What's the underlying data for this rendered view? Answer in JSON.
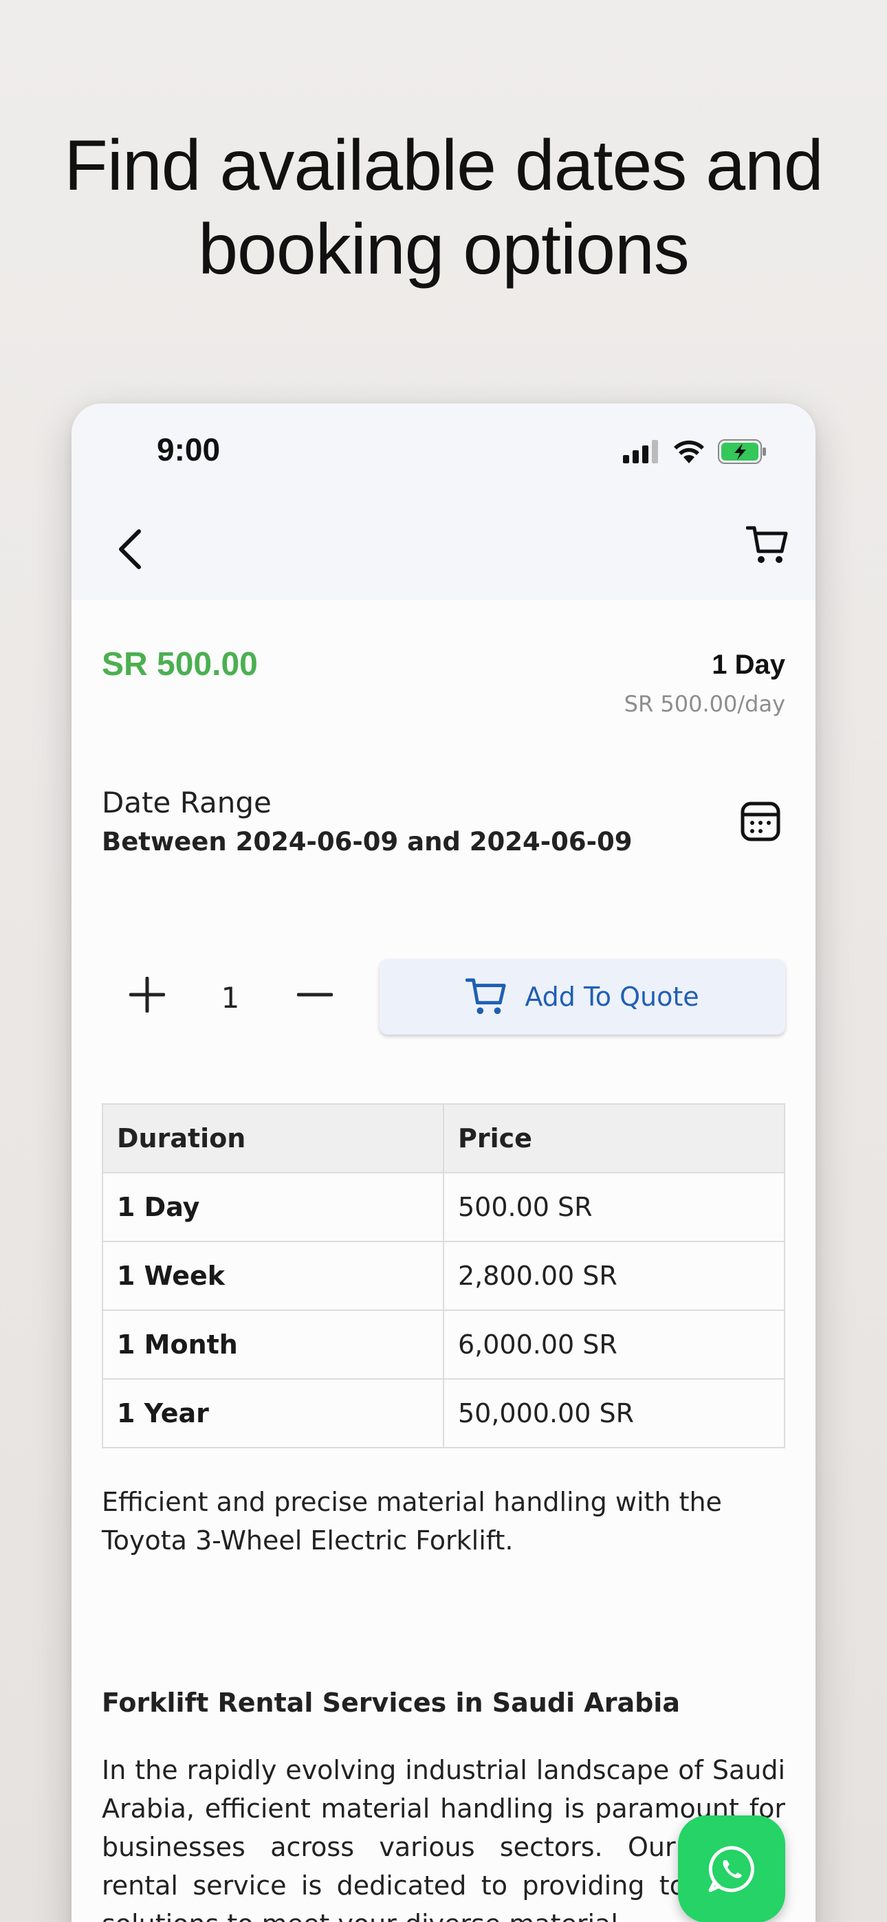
{
  "headline": {
    "line1": "Find available dates and",
    "line2": "booking options"
  },
  "status_bar": {
    "time": "9:00"
  },
  "nav": {
    "back_icon": "chevron-left-icon",
    "cart_icon": "cart-icon"
  },
  "pricing": {
    "price": "SR 500.00",
    "duration": "1 Day",
    "per_day": "SR 500.00/day"
  },
  "date_range": {
    "label": "Date Range",
    "value": "Between 2024-06-09 and 2024-06-09"
  },
  "quantity": {
    "value": "1"
  },
  "add_to_quote": {
    "label": "Add To Quote"
  },
  "price_table": {
    "headers": [
      "Duration",
      "Price"
    ],
    "rows": [
      {
        "duration": "1 Day",
        "price": "500.00 SR"
      },
      {
        "duration": "1 Week",
        "price": "2,800.00 SR"
      },
      {
        "duration": "1 Month",
        "price": "6,000.00 SR"
      },
      {
        "duration": "1 Year",
        "price": "50,000.00 SR"
      }
    ]
  },
  "description": "Efficient and precise material handling with the Toyota 3-Wheel Electric Forklift.",
  "section": {
    "title": "Forklift Rental Services in Saudi Arabia",
    "body": "In the rapidly evolving industrial landscape of Saudi Arabia, efficient material handling is paramount for businesses across various sectors. Our forklift rental service is dedicated to providing top-notch solutions to meet your diverse material"
  },
  "colors": {
    "price_green": "#4caf50",
    "quote_blue": "#1f5fb3",
    "whatsapp_green": "#25d366"
  }
}
